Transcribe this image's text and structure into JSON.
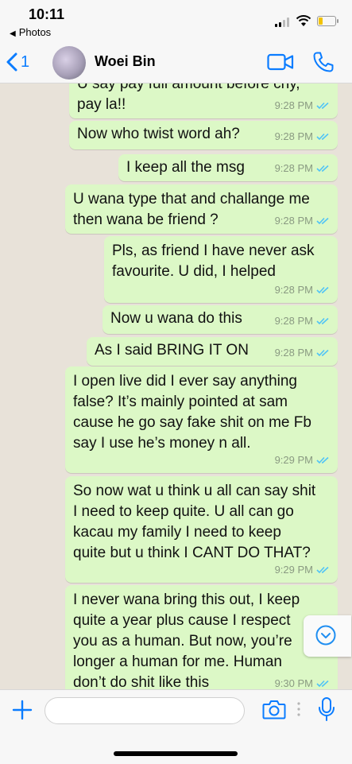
{
  "status_bar": {
    "time": "10:11",
    "back_app": "Photos"
  },
  "header": {
    "back_count": "1",
    "contact_name": "Woei Bin"
  },
  "messages": [
    {
      "text": "U say pay full amount before cny,\npay la!!",
      "time": "9:28 PM"
    },
    {
      "text": "Now who twist word ah?",
      "time": "9:28 PM"
    },
    {
      "text": "I keep all the msg",
      "time": "9:28 PM"
    },
    {
      "text": "U wana type that and challange me\nthen wana be friend ?",
      "time": "9:28 PM"
    },
    {
      "text": "Pls, as friend I have never ask\nfavourite. U did, I helped",
      "time": "9:28 PM"
    },
    {
      "text": "Now u wana do this",
      "time": "9:28 PM"
    },
    {
      "text": "As I said BRING IT ON",
      "time": "9:28 PM"
    },
    {
      "text": "I open live did I ever say anything\nfalse? It’s mainly pointed at sam\ncause he go say fake shit on me Fb\nsay I use he’s money n all.",
      "time": "9:29 PM"
    },
    {
      "text": "So now wat u think u all can say shit\nI need to keep quite. U all can go\nkacau my family I need to keep\nquite but u think I CANT DO THAT?",
      "time": "9:29 PM"
    },
    {
      "text": "I never wana bring this out, I keep\nquite a year plus cause I respect\nyou as a human. But now, you’re\nlonger a human for me. Human\ndon’t do shit like this",
      "time": "9:30 PM"
    }
  ],
  "input": {
    "placeholder": ""
  },
  "colors": {
    "outgoing_bubble": "#dcf8c6",
    "accent": "#0a7cff",
    "read_ticks": "#4fc3f7"
  }
}
